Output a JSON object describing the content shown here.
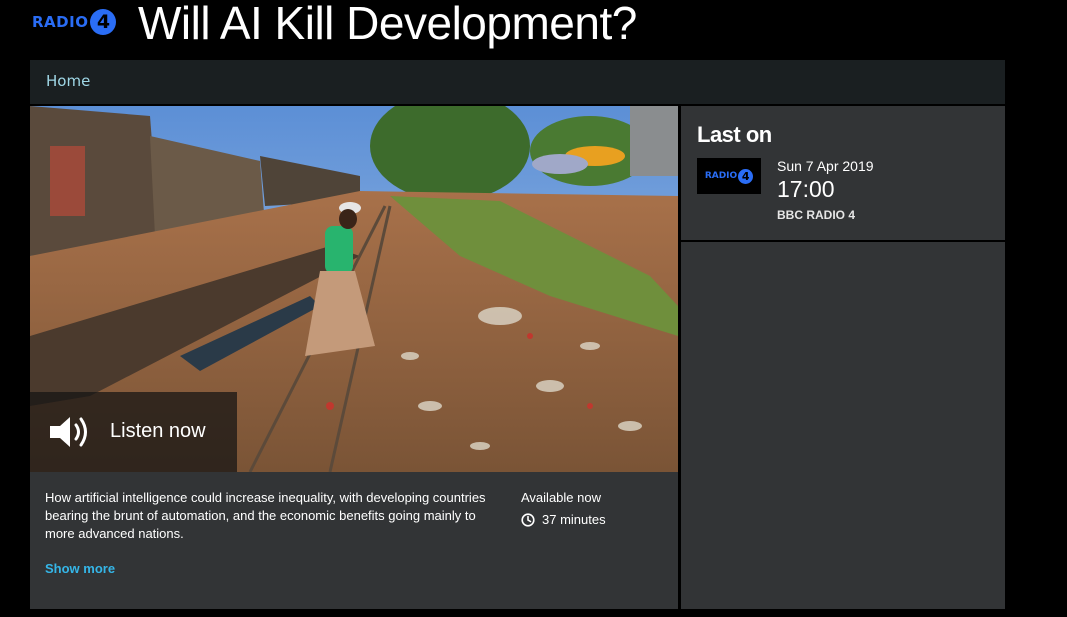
{
  "header": {
    "brand_word": "RADIO",
    "brand_number": "4",
    "title": "Will AI Kill Development?"
  },
  "nav": {
    "home_label": "Home"
  },
  "hero": {
    "listen_label": "Listen now",
    "icon": "speaker-icon"
  },
  "description": {
    "text": "How artificial intelligence could increase inequality, with developing countries bearing the brunt of automation, and the economic benefits going mainly to more advanced nations.",
    "availability": "Available now",
    "duration": "37 minutes",
    "duration_icon": "clock-icon",
    "show_more": "Show more"
  },
  "last_on": {
    "heading": "Last on",
    "logo_word": "RADIO",
    "logo_number": "4",
    "date": "Sun 7 Apr 2019",
    "time": "17:00",
    "station": "BBC RADIO 4"
  },
  "colors": {
    "background": "#000000",
    "panel": "#323436",
    "navbar": "#1a1f21",
    "link": "#35b6e8",
    "brand_blue": "#2a6df5"
  }
}
